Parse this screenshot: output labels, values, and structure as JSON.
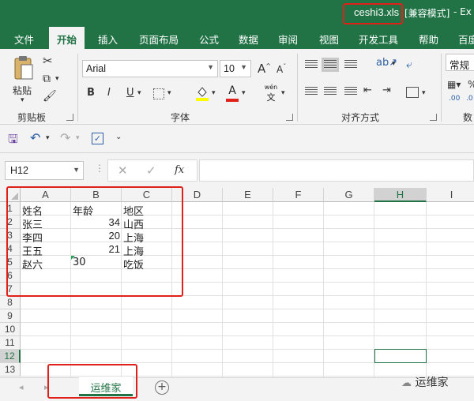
{
  "titlebar": {
    "filename": "ceshi3.xls",
    "mode": "[兼容模式]",
    "rest": "-  Ex"
  },
  "ribbon_tabs": [
    "文件",
    "开始",
    "插入",
    "页面布局",
    "公式",
    "数据",
    "审阅",
    "视图",
    "开发工具",
    "帮助",
    "百度"
  ],
  "active_tab": "开始",
  "clipboard": {
    "paste_label": "粘贴",
    "group_label": "剪贴板"
  },
  "font": {
    "name": "Arial",
    "size": "10",
    "grow": "A",
    "shrink": "A",
    "bold": "B",
    "italic": "I",
    "underline": "U",
    "phonetic": "wén",
    "phonetic_char": "文",
    "group_label": "字体"
  },
  "alignment": {
    "group_label": "对齐方式"
  },
  "number": {
    "format": "常规",
    "group_label": "数",
    "percent": "%",
    "dec_up": ".00",
    "dec_down": ".0"
  },
  "formula_bar": {
    "name_box": "H12",
    "fx": "fx",
    "value": ""
  },
  "columns": [
    "A",
    "B",
    "C",
    "D",
    "E",
    "F",
    "G",
    "H",
    "I"
  ],
  "selected_column": "H",
  "rows": [
    "1",
    "2",
    "3",
    "4",
    "5",
    "6",
    "7",
    "8",
    "9",
    "10",
    "11",
    "12",
    "13"
  ],
  "selected_row": "12",
  "cells": {
    "A1": "姓名",
    "B1": "年龄",
    "C1": "地区",
    "A2": "张三",
    "B2": "34",
    "C2": "山西",
    "A3": "李四",
    "B3": "20",
    "C3": "上海",
    "A4": "王五",
    "B4": "21",
    "C4": "上海",
    "A5": "赵六",
    "B5": "30",
    "C5": "吃饭"
  },
  "sheet_tabs": [
    "运维家"
  ],
  "add_sheet": "+",
  "watermark": "运维家",
  "colors": {
    "excel_green": "#217346",
    "highlight_red": "#e0201b"
  }
}
